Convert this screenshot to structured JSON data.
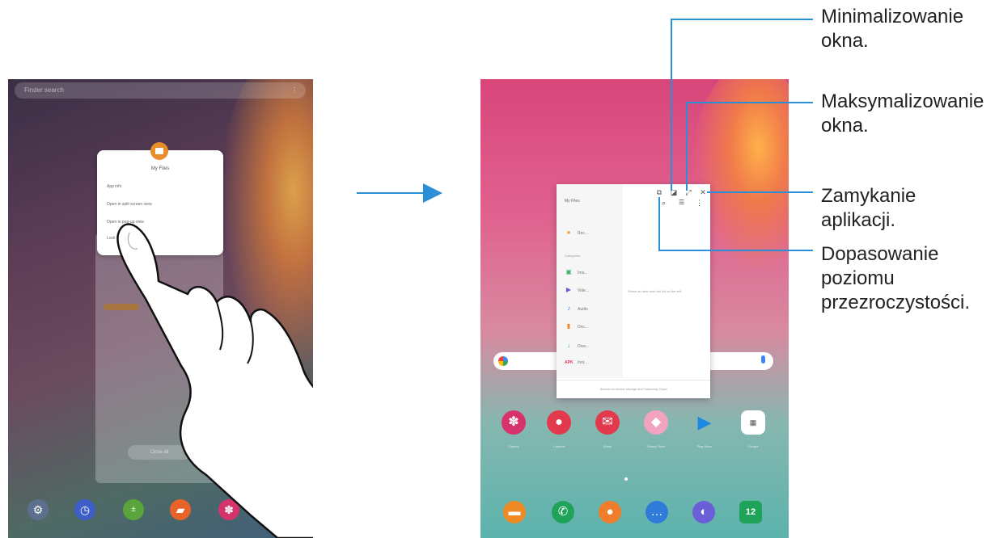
{
  "left_tablet": {
    "search_placeholder": "Finder search",
    "popup": {
      "title": "My Files",
      "options": [
        "App info",
        "Open in split screen view",
        "Open in pop-up view",
        "Lock this app"
      ]
    },
    "close_all": "Close all",
    "dock_icons": [
      "settings-icon",
      "clock-icon",
      "calculator-icon",
      "notes-icon",
      "gallery-icon",
      "galaxy-store-icon"
    ]
  },
  "right_tablet": {
    "popup_window": {
      "title": "My Files",
      "recent_label": "Rec...",
      "categories_label": "Categories",
      "items": [
        "Ima...",
        "Vide...",
        "Audio",
        "Doc...",
        "Dow...",
        "Inst..."
      ],
      "apk_label": "APK",
      "empty_message": "Select an item from the list on the left.",
      "footer": "Search on-device storage and Samsung Cloud"
    },
    "home_apps": [
      "Gallery",
      "Camera",
      "Email",
      "Galaxy Store",
      "Play Store",
      "Google"
    ],
    "calendar_day": "12"
  },
  "callouts": {
    "minimize": "Minimalizowanie\nokna.",
    "maximize": "Maksymalizowanie\nokna.",
    "close": "Zamykanie\naplikacji.",
    "transparency": "Dopasowanie\npoziomu\nprzezroczystości."
  },
  "colors": {
    "accent": "#2a8fd7"
  }
}
